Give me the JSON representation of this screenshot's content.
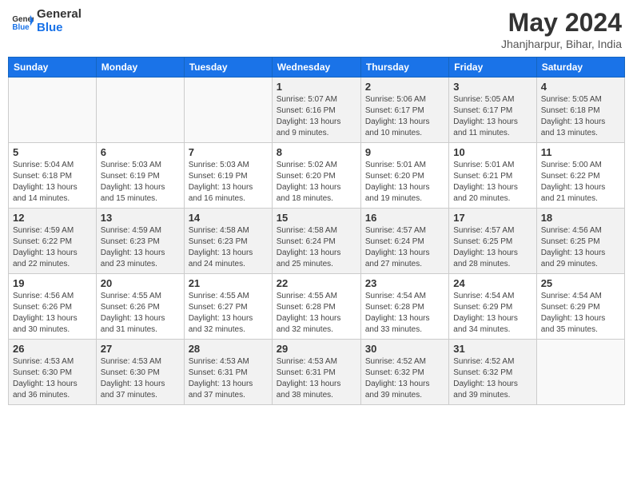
{
  "logo": {
    "line1": "General",
    "line2": "Blue"
  },
  "title": "May 2024",
  "subtitle": "Jhanjharpur, Bihar, India",
  "weekdays": [
    "Sunday",
    "Monday",
    "Tuesday",
    "Wednesday",
    "Thursday",
    "Friday",
    "Saturday"
  ],
  "weeks": [
    [
      {
        "day": "",
        "info": ""
      },
      {
        "day": "",
        "info": ""
      },
      {
        "day": "",
        "info": ""
      },
      {
        "day": "1",
        "info": "Sunrise: 5:07 AM\nSunset: 6:16 PM\nDaylight: 13 hours\nand 9 minutes."
      },
      {
        "day": "2",
        "info": "Sunrise: 5:06 AM\nSunset: 6:17 PM\nDaylight: 13 hours\nand 10 minutes."
      },
      {
        "day": "3",
        "info": "Sunrise: 5:05 AM\nSunset: 6:17 PM\nDaylight: 13 hours\nand 11 minutes."
      },
      {
        "day": "4",
        "info": "Sunrise: 5:05 AM\nSunset: 6:18 PM\nDaylight: 13 hours\nand 13 minutes."
      }
    ],
    [
      {
        "day": "5",
        "info": "Sunrise: 5:04 AM\nSunset: 6:18 PM\nDaylight: 13 hours\nand 14 minutes."
      },
      {
        "day": "6",
        "info": "Sunrise: 5:03 AM\nSunset: 6:19 PM\nDaylight: 13 hours\nand 15 minutes."
      },
      {
        "day": "7",
        "info": "Sunrise: 5:03 AM\nSunset: 6:19 PM\nDaylight: 13 hours\nand 16 minutes."
      },
      {
        "day": "8",
        "info": "Sunrise: 5:02 AM\nSunset: 6:20 PM\nDaylight: 13 hours\nand 18 minutes."
      },
      {
        "day": "9",
        "info": "Sunrise: 5:01 AM\nSunset: 6:20 PM\nDaylight: 13 hours\nand 19 minutes."
      },
      {
        "day": "10",
        "info": "Sunrise: 5:01 AM\nSunset: 6:21 PM\nDaylight: 13 hours\nand 20 minutes."
      },
      {
        "day": "11",
        "info": "Sunrise: 5:00 AM\nSunset: 6:22 PM\nDaylight: 13 hours\nand 21 minutes."
      }
    ],
    [
      {
        "day": "12",
        "info": "Sunrise: 4:59 AM\nSunset: 6:22 PM\nDaylight: 13 hours\nand 22 minutes."
      },
      {
        "day": "13",
        "info": "Sunrise: 4:59 AM\nSunset: 6:23 PM\nDaylight: 13 hours\nand 23 minutes."
      },
      {
        "day": "14",
        "info": "Sunrise: 4:58 AM\nSunset: 6:23 PM\nDaylight: 13 hours\nand 24 minutes."
      },
      {
        "day": "15",
        "info": "Sunrise: 4:58 AM\nSunset: 6:24 PM\nDaylight: 13 hours\nand 25 minutes."
      },
      {
        "day": "16",
        "info": "Sunrise: 4:57 AM\nSunset: 6:24 PM\nDaylight: 13 hours\nand 27 minutes."
      },
      {
        "day": "17",
        "info": "Sunrise: 4:57 AM\nSunset: 6:25 PM\nDaylight: 13 hours\nand 28 minutes."
      },
      {
        "day": "18",
        "info": "Sunrise: 4:56 AM\nSunset: 6:25 PM\nDaylight: 13 hours\nand 29 minutes."
      }
    ],
    [
      {
        "day": "19",
        "info": "Sunrise: 4:56 AM\nSunset: 6:26 PM\nDaylight: 13 hours\nand 30 minutes."
      },
      {
        "day": "20",
        "info": "Sunrise: 4:55 AM\nSunset: 6:26 PM\nDaylight: 13 hours\nand 31 minutes."
      },
      {
        "day": "21",
        "info": "Sunrise: 4:55 AM\nSunset: 6:27 PM\nDaylight: 13 hours\nand 32 minutes."
      },
      {
        "day": "22",
        "info": "Sunrise: 4:55 AM\nSunset: 6:28 PM\nDaylight: 13 hours\nand 32 minutes."
      },
      {
        "day": "23",
        "info": "Sunrise: 4:54 AM\nSunset: 6:28 PM\nDaylight: 13 hours\nand 33 minutes."
      },
      {
        "day": "24",
        "info": "Sunrise: 4:54 AM\nSunset: 6:29 PM\nDaylight: 13 hours\nand 34 minutes."
      },
      {
        "day": "25",
        "info": "Sunrise: 4:54 AM\nSunset: 6:29 PM\nDaylight: 13 hours\nand 35 minutes."
      }
    ],
    [
      {
        "day": "26",
        "info": "Sunrise: 4:53 AM\nSunset: 6:30 PM\nDaylight: 13 hours\nand 36 minutes."
      },
      {
        "day": "27",
        "info": "Sunrise: 4:53 AM\nSunset: 6:30 PM\nDaylight: 13 hours\nand 37 minutes."
      },
      {
        "day": "28",
        "info": "Sunrise: 4:53 AM\nSunset: 6:31 PM\nDaylight: 13 hours\nand 37 minutes."
      },
      {
        "day": "29",
        "info": "Sunrise: 4:53 AM\nSunset: 6:31 PM\nDaylight: 13 hours\nand 38 minutes."
      },
      {
        "day": "30",
        "info": "Sunrise: 4:52 AM\nSunset: 6:32 PM\nDaylight: 13 hours\nand 39 minutes."
      },
      {
        "day": "31",
        "info": "Sunrise: 4:52 AM\nSunset: 6:32 PM\nDaylight: 13 hours\nand 39 minutes."
      },
      {
        "day": "",
        "info": ""
      }
    ]
  ]
}
